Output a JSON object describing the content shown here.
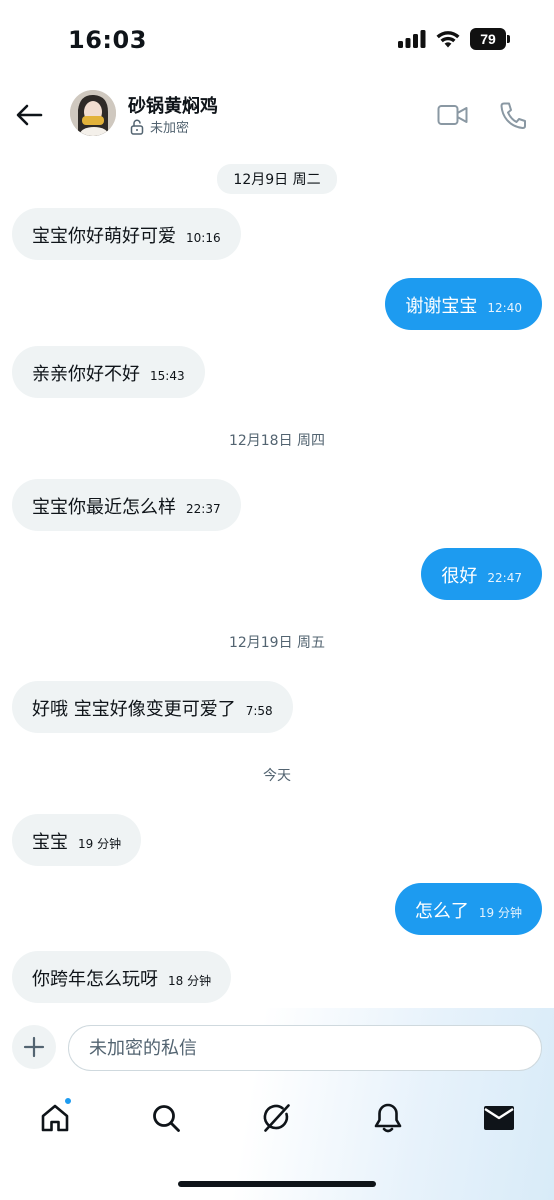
{
  "status": {
    "time": "16:03",
    "battery": "79"
  },
  "header": {
    "name": "砂锅黄焖鸡",
    "encryption": "未加密"
  },
  "messages": [
    {
      "type": "date",
      "label": "12月9日 周二"
    },
    {
      "type": "in",
      "text": "宝宝你好萌好可爱",
      "time": "10:16"
    },
    {
      "type": "out",
      "text": "谢谢宝宝",
      "time": "12:40"
    },
    {
      "type": "in",
      "text": "亲亲你好不好",
      "time": "15:43"
    },
    {
      "type": "date",
      "label": "12月18日 周四"
    },
    {
      "type": "in",
      "text": "宝宝你最近怎么样",
      "time": "22:37"
    },
    {
      "type": "out",
      "text": "很好",
      "time": "22:47"
    },
    {
      "type": "date",
      "label": "12月19日 周五"
    },
    {
      "type": "in",
      "text": "好哦 宝宝好像变更可爱了",
      "time": "7:58"
    },
    {
      "type": "date",
      "label": "今天"
    },
    {
      "type": "in",
      "text": "宝宝",
      "time": "19 分钟"
    },
    {
      "type": "out",
      "text": "怎么了",
      "time": "19 分钟"
    },
    {
      "type": "in",
      "text": "你跨年怎么玩呀",
      "time": "18 分钟"
    }
  ],
  "composer": {
    "placeholder": "未加密的私信"
  },
  "nav": [
    "home-icon",
    "search-icon",
    "grok-icon",
    "notifications-icon",
    "messages-icon"
  ],
  "colors": {
    "accent": "#1d9bf0",
    "incoming_bubble": "#eff3f4",
    "text": "#0f1419",
    "secondary": "#536471"
  }
}
